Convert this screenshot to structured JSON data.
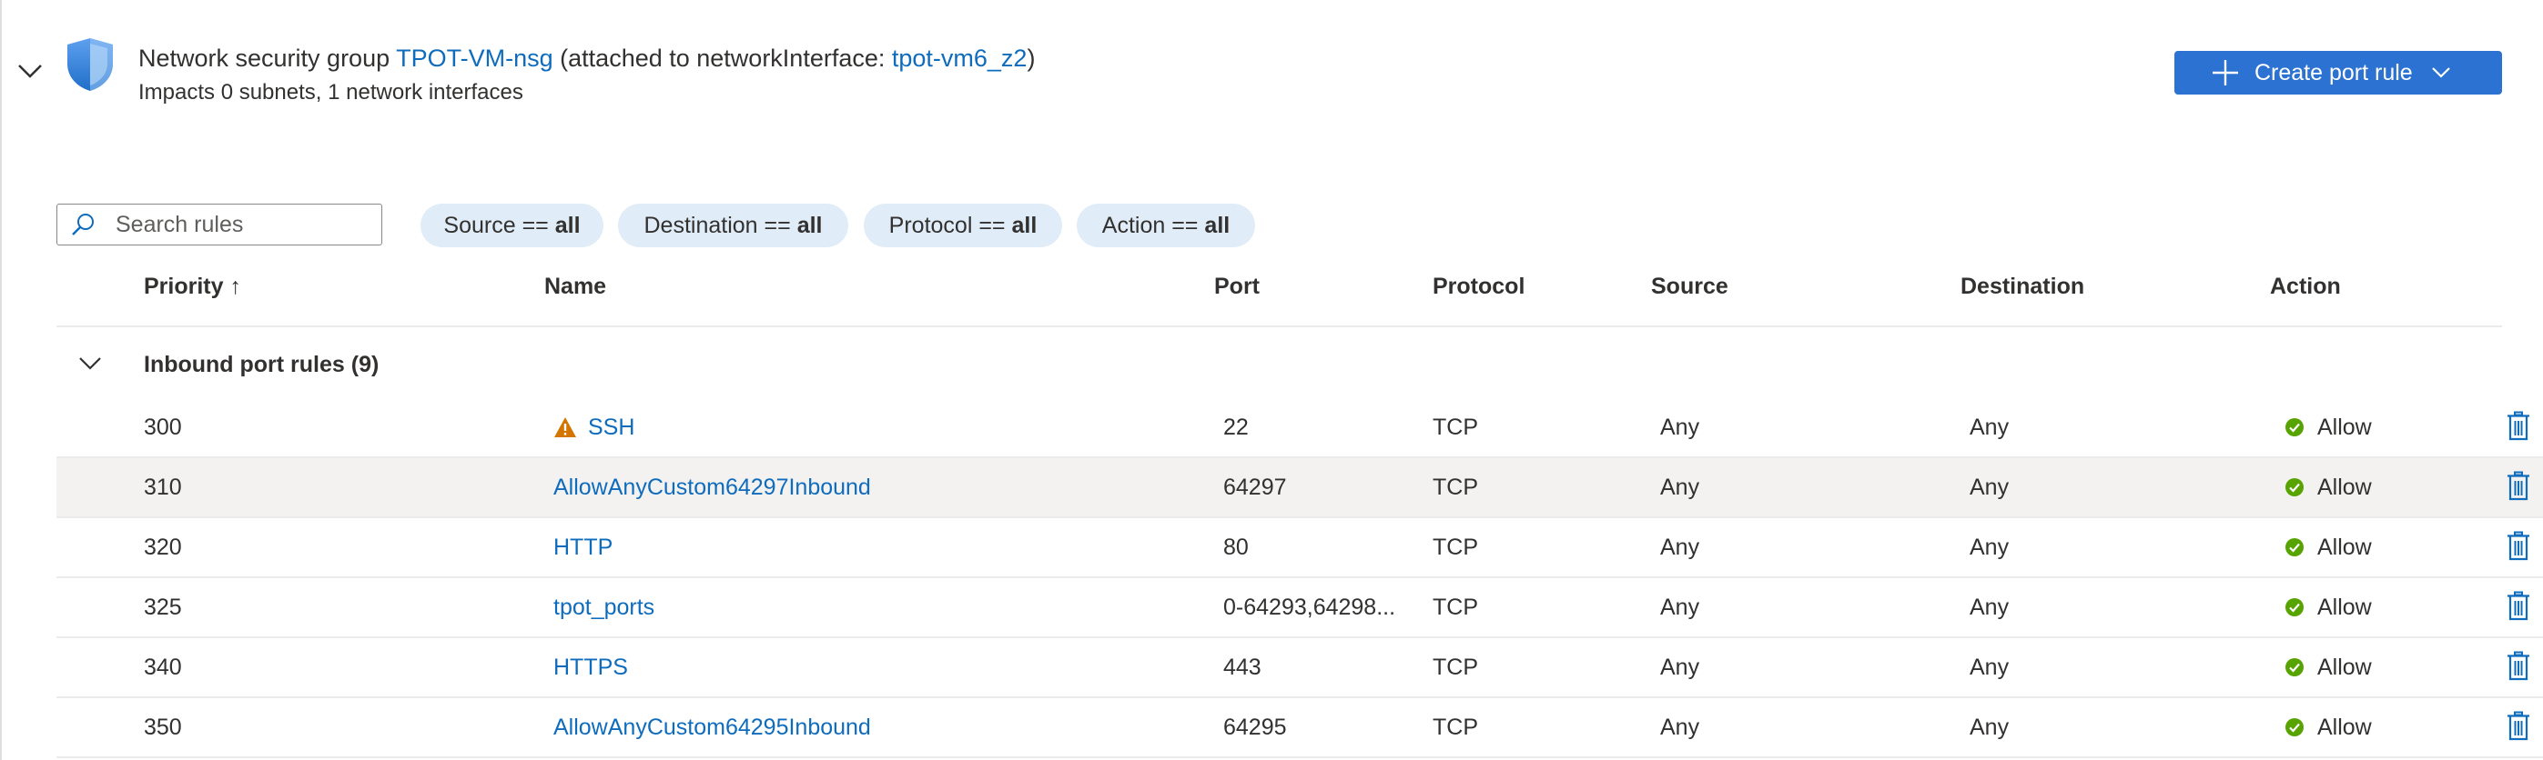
{
  "nsg": {
    "prefix": "Network security group",
    "name": "TPOT-VM-nsg",
    "attached_prefix": "(attached to networkInterface: ",
    "interface": "tpot-vm6_z2",
    "attached_suffix": ")",
    "impacts": "Impacts 0 subnets, 1 network interfaces"
  },
  "toolbar": {
    "create_label": "Create port rule"
  },
  "search": {
    "placeholder": "Search rules"
  },
  "filters": [
    {
      "label": "Source ==",
      "value": "all"
    },
    {
      "label": "Destination ==",
      "value": "all"
    },
    {
      "label": "Protocol ==",
      "value": "all"
    },
    {
      "label": "Action ==",
      "value": "all"
    }
  ],
  "table": {
    "columns": {
      "priority": "Priority ↑",
      "name": "Name",
      "port": "Port",
      "protocol": "Protocol",
      "source": "Source",
      "destination": "Destination",
      "action": "Action"
    },
    "group_label": "Inbound port rules (9)",
    "rows": [
      {
        "priority": "300",
        "name": "SSH",
        "warning": true,
        "port": "22",
        "protocol": "TCP",
        "source": "Any",
        "destination": "Any",
        "action": "Allow"
      },
      {
        "priority": "310",
        "name": "AllowAnyCustom64297Inbound",
        "warning": false,
        "port": "64297",
        "protocol": "TCP",
        "source": "Any",
        "destination": "Any",
        "action": "Allow"
      },
      {
        "priority": "320",
        "name": "HTTP",
        "warning": false,
        "port": "80",
        "protocol": "TCP",
        "source": "Any",
        "destination": "Any",
        "action": "Allow"
      },
      {
        "priority": "325",
        "name": "tpot_ports",
        "warning": false,
        "port": "0-64293,64298...",
        "protocol": "TCP",
        "source": "Any",
        "destination": "Any",
        "action": "Allow"
      },
      {
        "priority": "340",
        "name": "HTTPS",
        "warning": false,
        "port": "443",
        "protocol": "TCP",
        "source": "Any",
        "destination": "Any",
        "action": "Allow"
      },
      {
        "priority": "350",
        "name": "AllowAnyCustom64295Inbound",
        "warning": false,
        "port": "64295",
        "protocol": "TCP",
        "source": "Any",
        "destination": "Any",
        "action": "Allow"
      }
    ]
  },
  "colors": {
    "accent": "#0f6cbd",
    "button": "#2b72d2",
    "allow": "#57a300",
    "warning": "#d47500",
    "pill": "#e0ecf7",
    "row_shade": "#f3f2f1"
  },
  "icons": {
    "collapse": "chevron-down-icon",
    "nsg": "shield-icon",
    "create": "plus-icon",
    "dropdown": "chevron-down-icon",
    "search": "search-icon",
    "warning": "warning-icon",
    "allow": "check-circle-icon",
    "delete": "trash-icon"
  }
}
